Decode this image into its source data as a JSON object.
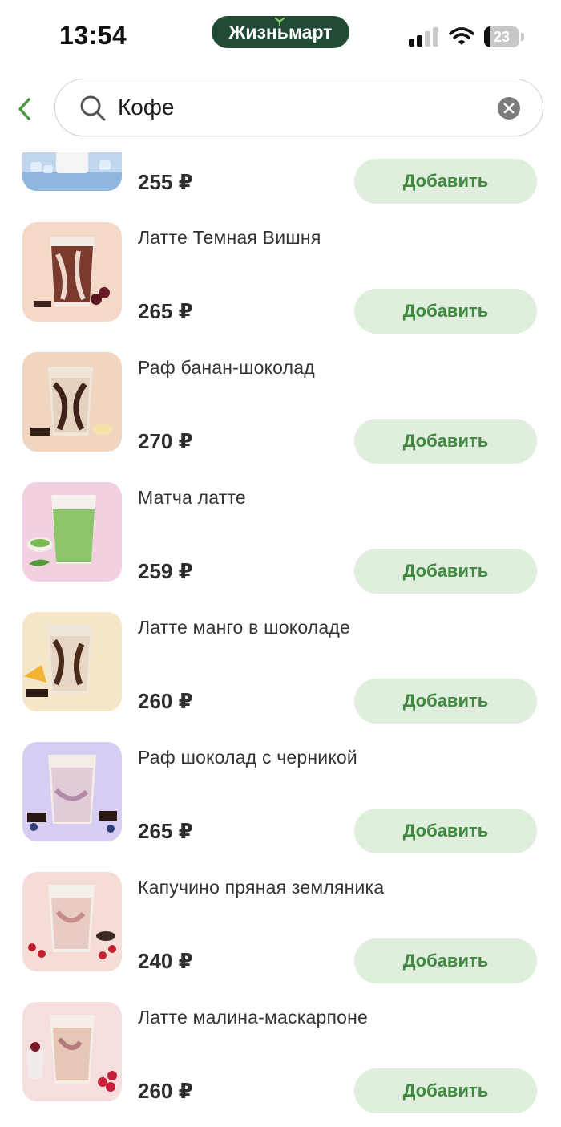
{
  "status_bar": {
    "time": "13:54",
    "brand": "Жизньмарт",
    "battery": "23"
  },
  "search": {
    "value": "Кофе",
    "placeholder": ""
  },
  "colors": {
    "brand_green": "#214b34",
    "accent_green": "#3f8a3f",
    "button_bg": "#dfeedd"
  },
  "icons": {
    "back": "chevron-left-icon",
    "search": "search-icon",
    "clear": "close-icon"
  },
  "add_label": "Добавить",
  "products": [
    {
      "name": "",
      "price": "255 ₽",
      "add_label": "Добавить",
      "bg": "#bfd6ee"
    },
    {
      "name": "Латте Темная Вишня",
      "price": "265 ₽",
      "add_label": "Добавить",
      "bg": "#f3d9c6"
    },
    {
      "name": "Раф банан-шоколад",
      "price": "270 ₽",
      "add_label": "Добавить",
      "bg": "#f0d6c1"
    },
    {
      "name": "Матча латте",
      "price": "259 ₽",
      "add_label": "Добавить",
      "bg": "#f3cfe2"
    },
    {
      "name": "Латте манго в шоколаде",
      "price": "260 ₽",
      "add_label": "Добавить",
      "bg": "#f6e6c8"
    },
    {
      "name": "Раф шоколад с черникой",
      "price": "265 ₽",
      "add_label": "Добавить",
      "bg": "#d7cdf2"
    },
    {
      "name": "Капучино пряная земляника",
      "price": "240 ₽",
      "add_label": "Добавить",
      "bg": "#f6dcd6"
    },
    {
      "name": "Латте малина-маскарпоне",
      "price": "260 ₽",
      "add_label": "Добавить",
      "bg": "#f7dede"
    }
  ]
}
